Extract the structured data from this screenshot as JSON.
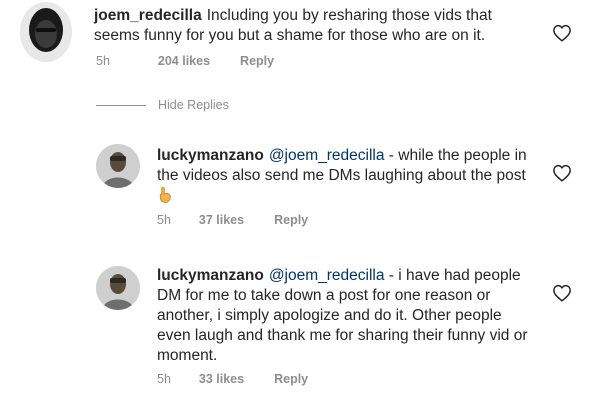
{
  "comments": [
    {
      "username": "joem_redecilla",
      "mention": "",
      "text": "Including you by resharing those vids that seems funny for you but a shame for those who are on it.",
      "time": "5h",
      "likes": "204 likes",
      "reply_label": "Reply"
    }
  ],
  "hide_replies_label": "Hide Replies",
  "replies": [
    {
      "username": "luckymanzano",
      "mention": "@joem_redecilla",
      "text": " - while the people in the videos also send me DMs laughing about the post",
      "emoji": "hand-emoji",
      "time": "5h",
      "likes": "37 likes",
      "reply_label": "Reply"
    },
    {
      "username": "luckymanzano",
      "mention": "@joem_redecilla",
      "text": " - i have had people DM for me to take down a post for one reason or another, i simply apologize and do it. Other people even laugh and thank me for sharing their funny vid or moment.",
      "time": "5h",
      "likes": "33 likes",
      "reply_label": "Reply"
    }
  ],
  "icons": {
    "like": "heart-outline-icon",
    "avatar": "profile-photo"
  }
}
